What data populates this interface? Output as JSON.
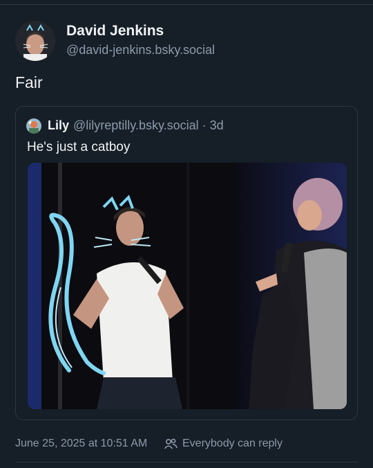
{
  "post": {
    "author": {
      "display_name": "David Jenkins",
      "handle": "@david-jenkins.bsky.social"
    },
    "text": "Fair"
  },
  "quote": {
    "author_name": "Lily",
    "handle_time": "@lilyreptilly.bsky.social · 3d",
    "text": "He's just a catboy"
  },
  "meta": {
    "date": "June 25, 2025 at 10:51 AM",
    "reply_setting": "Everybody can reply"
  },
  "colors": {
    "background": "#161e27",
    "border": "#2b3847",
    "muted_text": "#8c9bac",
    "primary_text": "#f1f3f5"
  }
}
